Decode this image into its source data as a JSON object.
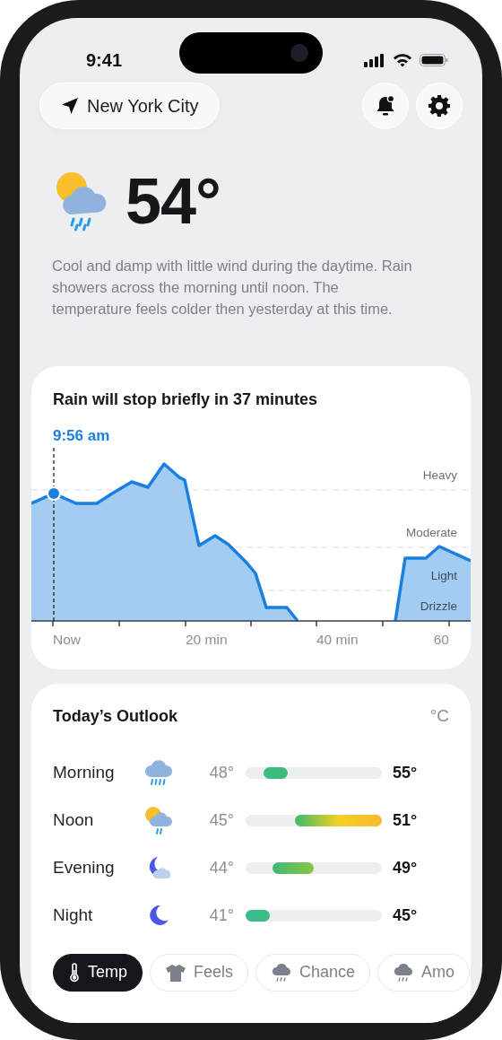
{
  "status_bar": {
    "time": "9:41"
  },
  "header": {
    "location": "New York City"
  },
  "current": {
    "temperature": "54°",
    "description": "Cool and damp with little wind during the daytime. Rain showers across the morning until noon. The temperature feels colder then yesterday at this time."
  },
  "rain_card": {
    "title": "Rain will stop briefly in 37 minutes",
    "cursor_time": "9:56 am",
    "intensity_labels": [
      "Heavy",
      "Moderate",
      "Light",
      "Drizzle"
    ],
    "x_labels": [
      "Now",
      "20 min",
      "40 min",
      "60"
    ]
  },
  "outlook": {
    "title": "Today’s Outlook",
    "unit": "°C",
    "rows": [
      {
        "label": "Morning",
        "kind": "rain",
        "low": "48°",
        "high": "55°",
        "bar": {
          "kind": "cool",
          "fill": {
            "level": 0.18
          }
        }
      },
      {
        "label": "Noon",
        "kind": "sun-rain",
        "low": "45°",
        "high": "51°",
        "bar": {
          "kind": "warm",
          "fill": {
            "level": 0.64
          }
        }
      },
      {
        "label": "Evening",
        "kind": "moon-cloud",
        "low": "44°",
        "high": "49°",
        "bar": {
          "kind": "mild",
          "fill": {
            "level": 0.3
          }
        }
      },
      {
        "label": "Night",
        "kind": "moon",
        "low": "41°",
        "high": "45°",
        "bar": {
          "kind": "cold",
          "fill": {
            "level": 0.18
          }
        }
      }
    ]
  },
  "chips": [
    {
      "label": "Temp",
      "kind": "thermometer",
      "selected": true
    },
    {
      "label": "Feels",
      "kind": "shirt",
      "selected": false
    },
    {
      "label": "Chance",
      "kind": "rain",
      "selected": false
    },
    {
      "label": "Amo",
      "kind": "rain",
      "selected": false
    }
  ]
}
